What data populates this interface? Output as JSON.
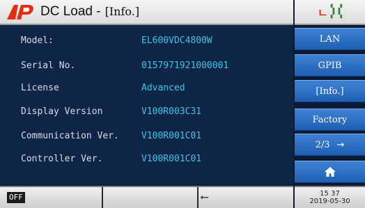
{
  "header": {
    "logo_text": "AP",
    "title": "DC Load -",
    "mode": "[Info.]",
    "remote_icon": "remote-L-icon",
    "status_icon": "indicator-bars-icon"
  },
  "info": [
    {
      "label": "Model:",
      "value": "EL600VDC4800W"
    },
    {
      "label": "Serial No.",
      "value": "0157971921000001"
    },
    {
      "label": "License",
      "value": "Advanced"
    },
    {
      "label": "Display Version",
      "value": "V100R003C31"
    },
    {
      "label": "Communication Ver.",
      "value": "V100R001C01"
    },
    {
      "label": "Controller Ver.",
      "value": "V100R001C01"
    }
  ],
  "sidebar": {
    "lan": "LAN",
    "gpib": "GPIB",
    "info": "[Info.]",
    "factory": "Factory",
    "page": "2/3",
    "page_arrow": "→",
    "home_icon": "home-icon"
  },
  "footer": {
    "output_state": "OFF",
    "usb_icon": "usb-icon",
    "time": "15 37",
    "date": "2019-05-30"
  },
  "colors": {
    "background": "#0f2547",
    "value_text": "#3ec5e6",
    "button": "#2a6cc0",
    "logo": "#e03010"
  }
}
